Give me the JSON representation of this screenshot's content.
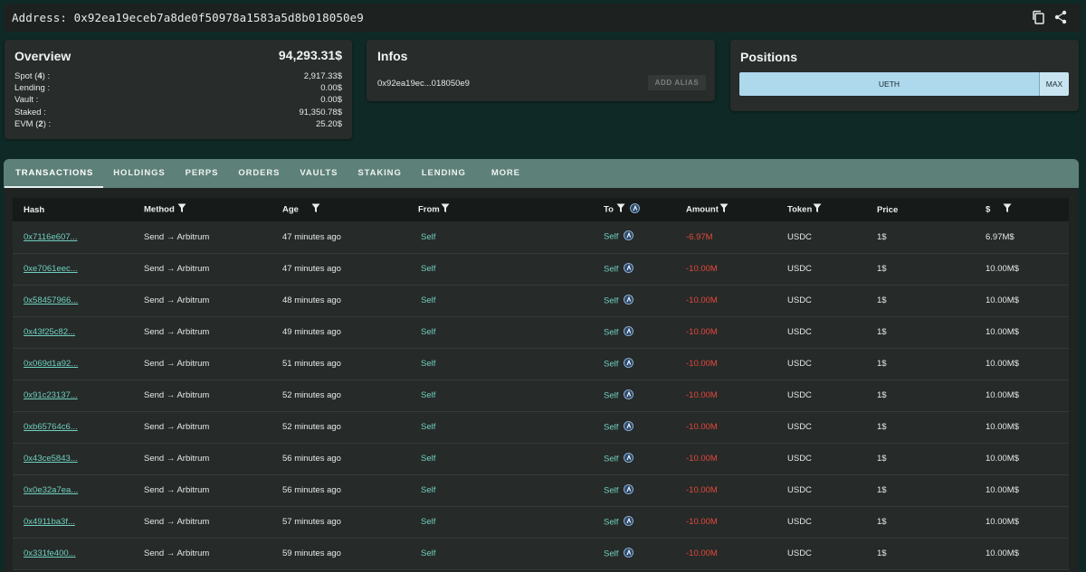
{
  "address": {
    "label": "Address: 0x92ea19eceb7a8de0f50978a1583a5d8b018050e9"
  },
  "overview": {
    "title": "Overview",
    "total": "94,293.31$",
    "rows": [
      {
        "label_pre": "Spot (",
        "count": "4",
        "label_post": ") :",
        "value": "2,917.33$"
      },
      {
        "label_pre": "Lending :",
        "count": "",
        "label_post": "",
        "value": "0.00$"
      },
      {
        "label_pre": "Vault :",
        "count": "",
        "label_post": "",
        "value": "0.00$"
      },
      {
        "label_pre": "Staked :",
        "count": "",
        "label_post": "",
        "value": "91,350.78$"
      },
      {
        "label_pre": "EVM (",
        "count": "2",
        "label_post": ") :",
        "value": "25.20$"
      }
    ]
  },
  "infos": {
    "title": "Infos",
    "short_address": "0x92ea19ec...018050e9",
    "alias_button": "ADD ALIAS"
  },
  "positions": {
    "title": "Positions",
    "segments": [
      {
        "label": "UETH",
        "share": 0.91
      },
      {
        "label": "MAX",
        "share": 0.09
      }
    ]
  },
  "tabs": [
    "TRANSACTIONS",
    "HOLDINGS",
    "PERPS",
    "ORDERS",
    "VAULTS",
    "STAKING",
    "LENDING",
    "MORE"
  ],
  "active_tab": "TRANSACTIONS",
  "table": {
    "headers": [
      "Hash",
      "Method",
      "Age",
      "From",
      "To",
      "Amount",
      "Token",
      "Price",
      "$"
    ],
    "rows": [
      {
        "hash": "0x7116e607...",
        "method": "Send → Arbitrum",
        "age": "47 minutes ago",
        "from": "Self",
        "to": "Self",
        "amount": "-6.97M",
        "token": "USDC",
        "price": "1$",
        "usd": "6.97M$"
      },
      {
        "hash": "0xe7061eec...",
        "method": "Send → Arbitrum",
        "age": "47 minutes ago",
        "from": "Self",
        "to": "Self",
        "amount": "-10.00M",
        "token": "USDC",
        "price": "1$",
        "usd": "10.00M$"
      },
      {
        "hash": "0x58457966...",
        "method": "Send → Arbitrum",
        "age": "48 minutes ago",
        "from": "Self",
        "to": "Self",
        "amount": "-10.00M",
        "token": "USDC",
        "price": "1$",
        "usd": "10.00M$"
      },
      {
        "hash": "0x43f25c82...",
        "method": "Send → Arbitrum",
        "age": "49 minutes ago",
        "from": "Self",
        "to": "Self",
        "amount": "-10.00M",
        "token": "USDC",
        "price": "1$",
        "usd": "10.00M$"
      },
      {
        "hash": "0x069d1a92...",
        "method": "Send → Arbitrum",
        "age": "51 minutes ago",
        "from": "Self",
        "to": "Self",
        "amount": "-10.00M",
        "token": "USDC",
        "price": "1$",
        "usd": "10.00M$"
      },
      {
        "hash": "0x91c23137...",
        "method": "Send → Arbitrum",
        "age": "52 minutes ago",
        "from": "Self",
        "to": "Self",
        "amount": "-10.00M",
        "token": "USDC",
        "price": "1$",
        "usd": "10.00M$"
      },
      {
        "hash": "0xb65764c6...",
        "method": "Send → Arbitrum",
        "age": "52 minutes ago",
        "from": "Self",
        "to": "Self",
        "amount": "-10.00M",
        "token": "USDC",
        "price": "1$",
        "usd": "10.00M$"
      },
      {
        "hash": "0x43ce5843...",
        "method": "Send → Arbitrum",
        "age": "56 minutes ago",
        "from": "Self",
        "to": "Self",
        "amount": "-10.00M",
        "token": "USDC",
        "price": "1$",
        "usd": "10.00M$"
      },
      {
        "hash": "0x0e32a7ea...",
        "method": "Send → Arbitrum",
        "age": "56 minutes ago",
        "from": "Self",
        "to": "Self",
        "amount": "-10.00M",
        "token": "USDC",
        "price": "1$",
        "usd": "10.00M$"
      },
      {
        "hash": "0x4911ba3f...",
        "method": "Send → Arbitrum",
        "age": "57 minutes ago",
        "from": "Self",
        "to": "Self",
        "amount": "-10.00M",
        "token": "USDC",
        "price": "1$",
        "usd": "10.00M$"
      },
      {
        "hash": "0x331fe400...",
        "method": "Send → Arbitrum",
        "age": "59 minutes ago",
        "from": "Self",
        "to": "Self",
        "amount": "-10.00M",
        "token": "USDC",
        "price": "1$",
        "usd": "10.00M$"
      }
    ]
  },
  "colors": {
    "background": "#0f2a26",
    "card": "#282c2b",
    "tabs": "#5d8078",
    "link": "#6fd0be",
    "negative": "#e5483b",
    "position_bar": "#aed8ec"
  },
  "icons": {
    "copy": "copy-icon",
    "share": "share-icon",
    "filter": "filter-icon",
    "arbitrum": "arbitrum-icon"
  }
}
